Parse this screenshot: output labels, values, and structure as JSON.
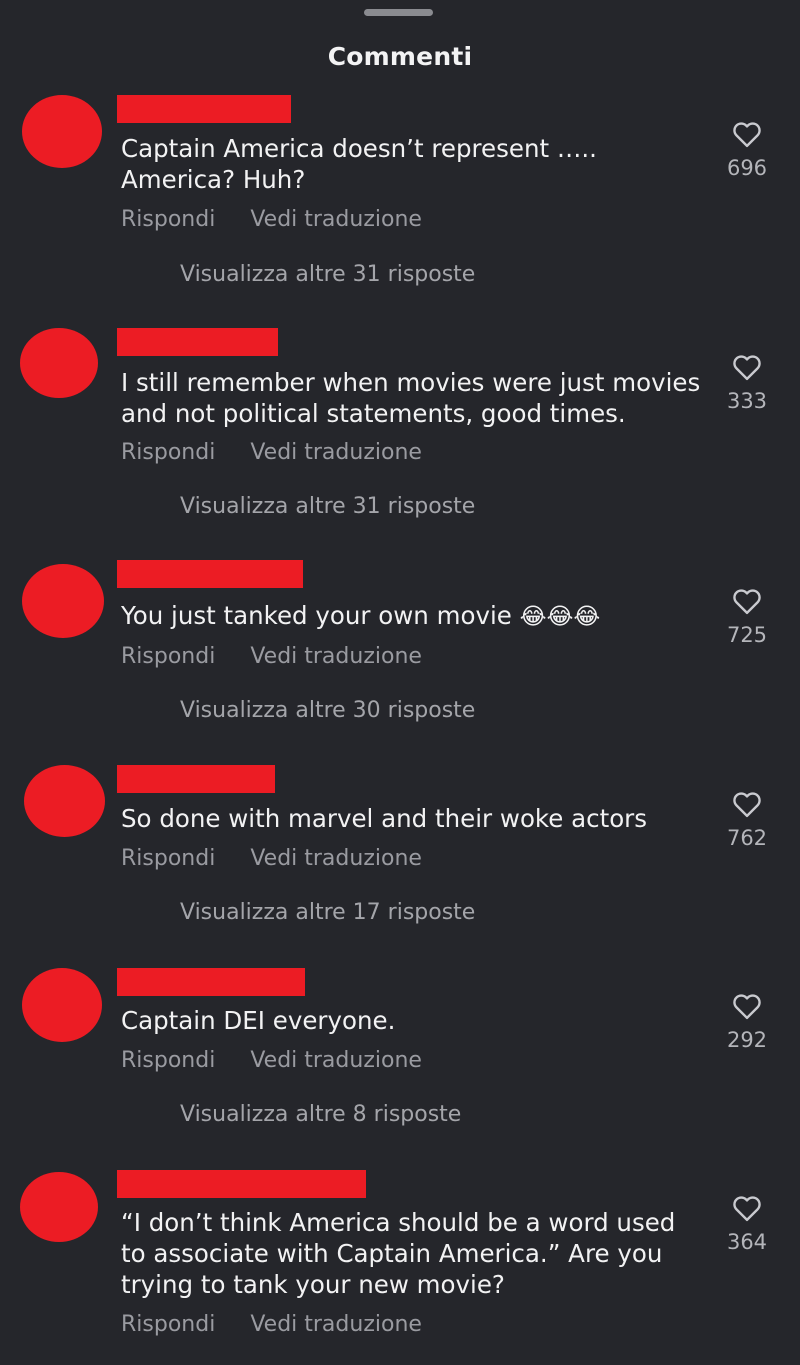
{
  "header": {
    "title": "Commenti"
  },
  "labels": {
    "reply": "Rispondi",
    "translate": "Vedi traduzione"
  },
  "comments": [
    {
      "text_lines": [
        "Captain America doesn’t represent …..",
        "America? Huh?"
      ],
      "likes": "696",
      "more_replies": "Visualizza altre 31 risposte"
    },
    {
      "text_lines": [
        "I still remember when movies were just movies",
        "and not political statements, good times."
      ],
      "likes": "333",
      "more_replies": "Visualizza altre 31 risposte"
    },
    {
      "text": "You just tanked your own movie",
      "emoji": "😂😂😂",
      "likes": "725",
      "more_replies": "Visualizza altre 30 risposte"
    },
    {
      "text": "So done with marvel and their woke actors",
      "likes": "762",
      "more_replies": "Visualizza altre 17 risposte"
    },
    {
      "text": "Captain DEI everyone.",
      "likes": "292",
      "more_replies": "Visualizza altre 8 risposte"
    },
    {
      "text_lines": [
        "“I don’t think America should be a word used",
        "to associate with Captain America.” Are you",
        "trying to tank your new movie?"
      ],
      "likes": "364"
    }
  ],
  "colors": {
    "background": "#25262b",
    "redaction": "#ec1c24",
    "secondary_text": "#9a9ba1"
  }
}
